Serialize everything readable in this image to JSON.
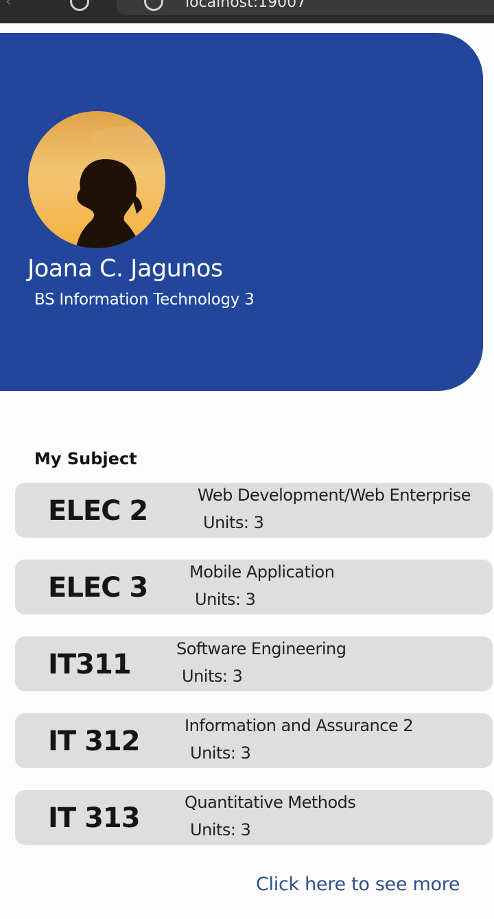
{
  "browser": {
    "url_text": "localhost:19007"
  },
  "profile": {
    "name": "Joana C. Jagunos",
    "program": "BS Information Technology 3"
  },
  "subjects_section": {
    "title": "My Subject",
    "items": [
      {
        "code": "ELEC 2",
        "name": "Web Development/Web Enterprise",
        "units": "Units: 3"
      },
      {
        "code": "ELEC 3",
        "name": "Mobile Application",
        "units": "Units: 3"
      },
      {
        "code": "IT311",
        "name": "Software Engineering",
        "units": "Units: 3"
      },
      {
        "code": "IT 312",
        "name": "Information and Assurance 2",
        "units": "Units: 3"
      },
      {
        "code": "IT 313",
        "name": "Quantitative Methods",
        "units": "Units: 3"
      }
    ]
  },
  "footer": {
    "more_link": "Click here to see more"
  },
  "colors": {
    "header_bg": "#21469b",
    "card_bg": "#dedede",
    "link": "#2f4f8f"
  }
}
